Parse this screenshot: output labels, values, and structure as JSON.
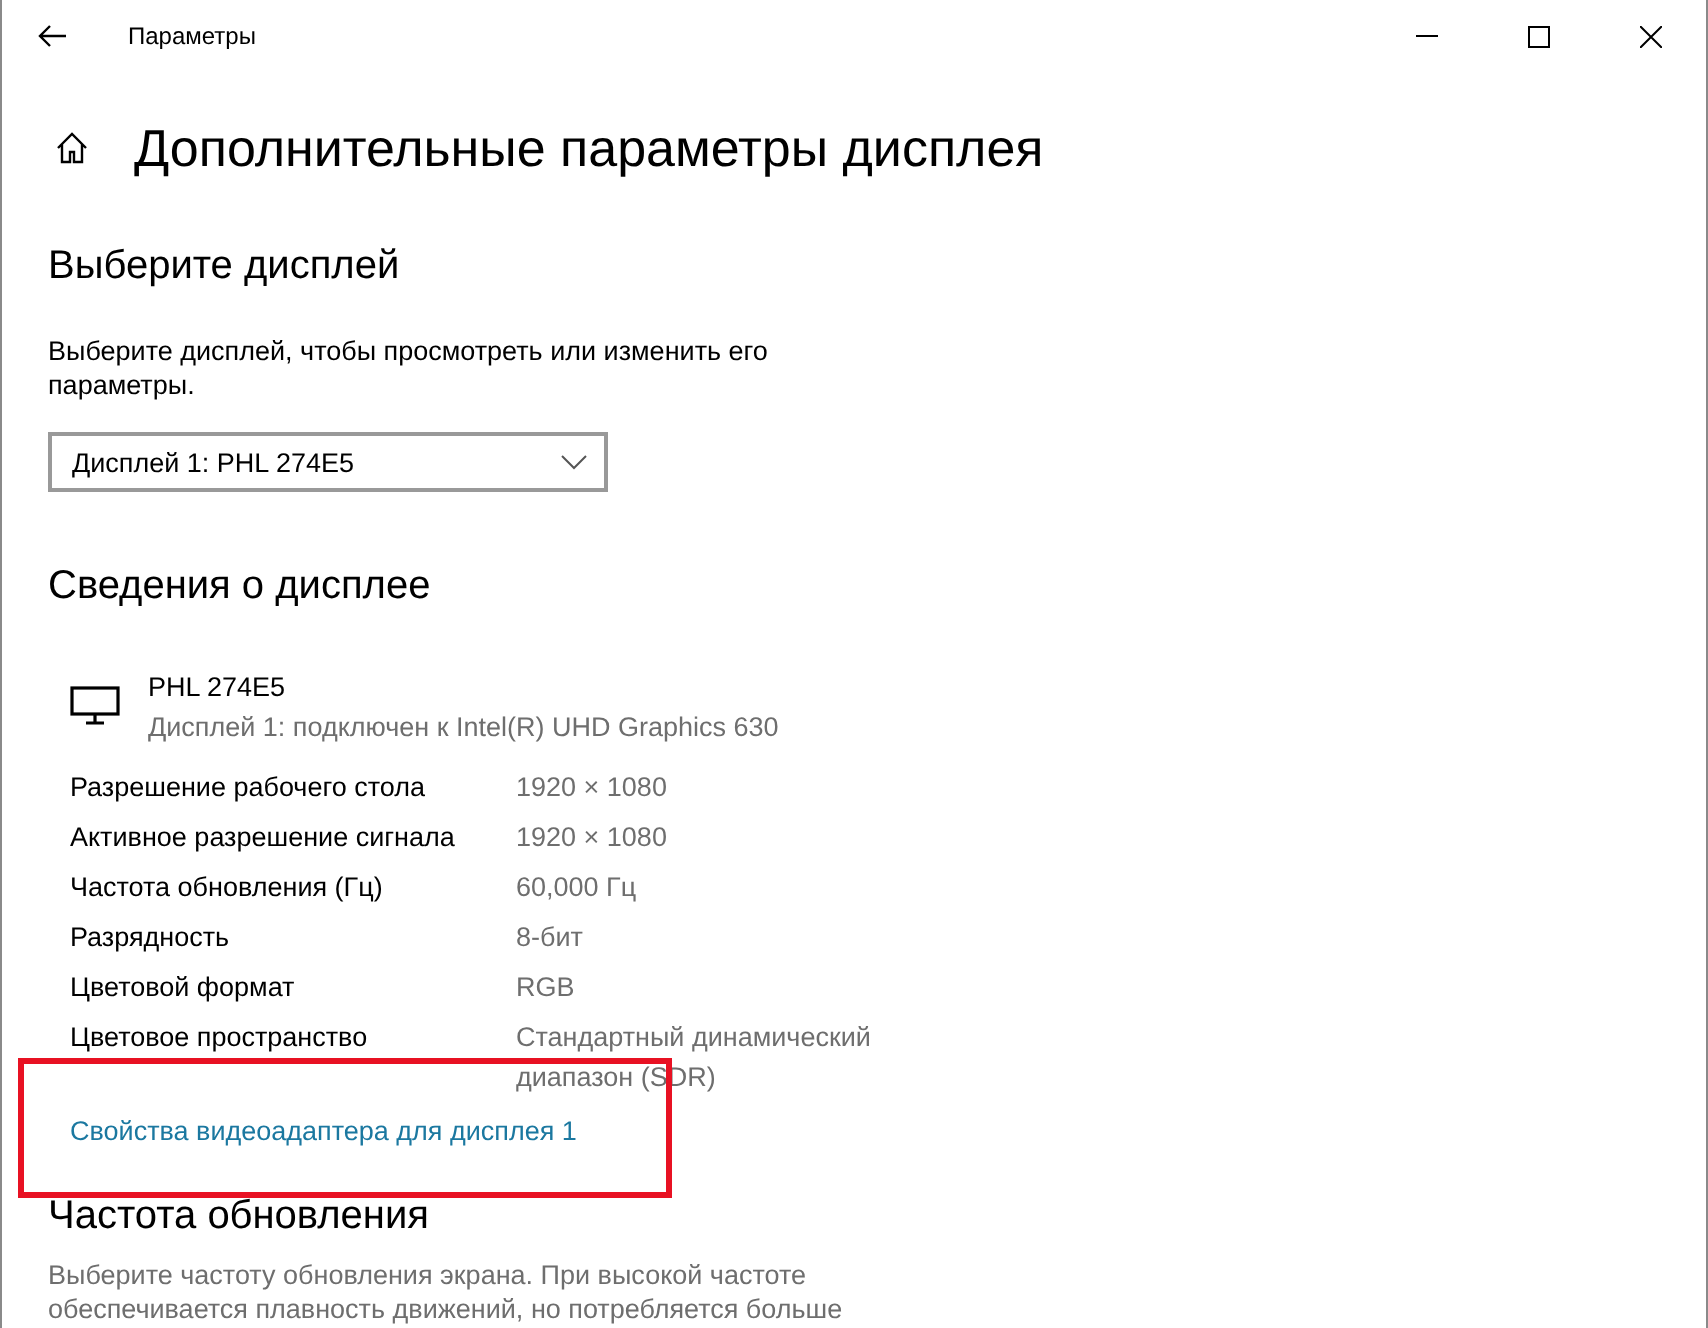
{
  "window": {
    "title": "Параметры"
  },
  "page_title": "Дополнительные параметры дисплея",
  "select_display": {
    "heading": "Выберите дисплей",
    "description": "Выберите дисплей, чтобы просмотреть или изменить его параметры.",
    "dropdown": {
      "value": "Дисплей 1: PHL 274E5"
    }
  },
  "display_info": {
    "heading": "Сведения о дисплее",
    "monitor": {
      "name": "PHL 274E5",
      "status": "Дисплей 1: подключен к Intel(R) UHD Graphics 630"
    },
    "properties": [
      {
        "label": "Разрешение рабочего стола",
        "value": "1920 × 1080"
      },
      {
        "label": "Активное разрешение сигнала",
        "value": "1920 × 1080"
      },
      {
        "label": "Частота обновления (Гц)",
        "value": "60,000 Гц"
      },
      {
        "label": "Разрядность",
        "value": "8-бит"
      },
      {
        "label": "Цветовой формат",
        "value": "RGB"
      },
      {
        "label": "Цветовое пространство",
        "value": "Стандартный динамический диапазон (SDR)"
      }
    ],
    "link": "Свойства видеоадаптера для дисплея 1"
  },
  "refresh_rate": {
    "heading": "Частота обновления",
    "description": "Выберите частоту обновления экрана. При высокой частоте обеспечивается плавность движений, но потребляется больше"
  },
  "annotation": {
    "kind": "frame",
    "color": "#e81123"
  }
}
